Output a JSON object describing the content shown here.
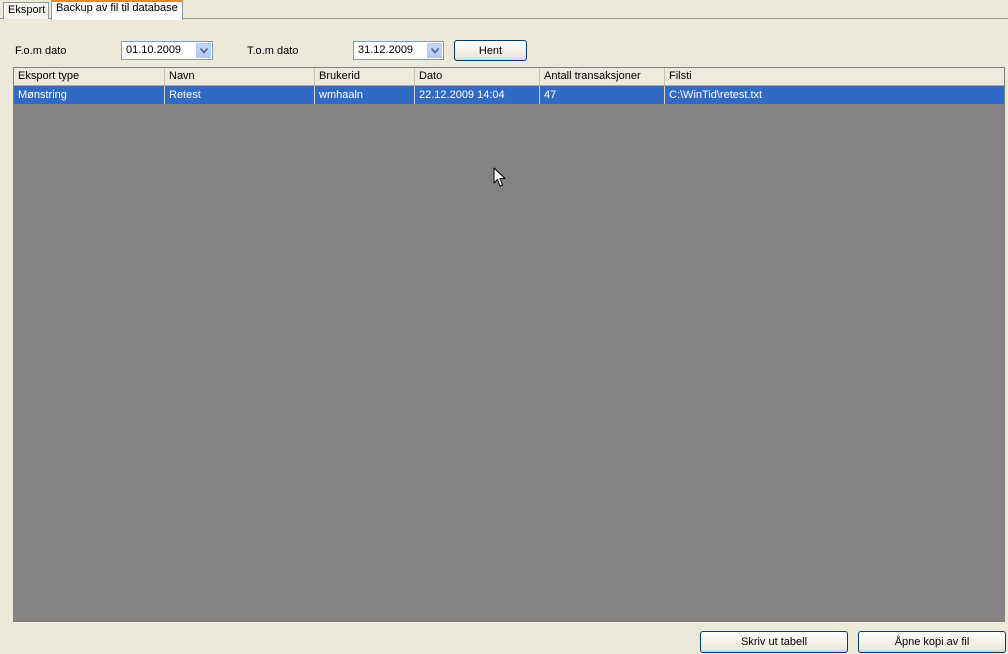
{
  "tabs": [
    {
      "label": "Eksport",
      "active": false
    },
    {
      "label": "Backup av fil til database",
      "active": true
    }
  ],
  "filter": {
    "from_label": "F.o.m dato",
    "from_value": "01.10.2009",
    "to_label": "T.o.m dato",
    "to_value": "31.12.2009",
    "fetch_button": "Hent"
  },
  "table": {
    "columns": [
      "Eksport type",
      "Navn",
      "Brukerid",
      "Dato",
      "Antall transaksjoner",
      "Filsti"
    ],
    "rows": [
      [
        "Mønstring",
        "Retest",
        "wmhaaln",
        "22.12.2009 14:04",
        "47",
        "C:\\WinTid\\retest.txt"
      ]
    ]
  },
  "footer": {
    "print_button": "Skriv ut tabell",
    "open_copy_button": "Åpne kopi av fil"
  },
  "colors": {
    "selection": "#316ac5",
    "grid_background": "#848284",
    "window_background": "#ece9d8"
  },
  "icons": [
    "dropdown-arrow-icon",
    "mouse-cursor-icon"
  ]
}
